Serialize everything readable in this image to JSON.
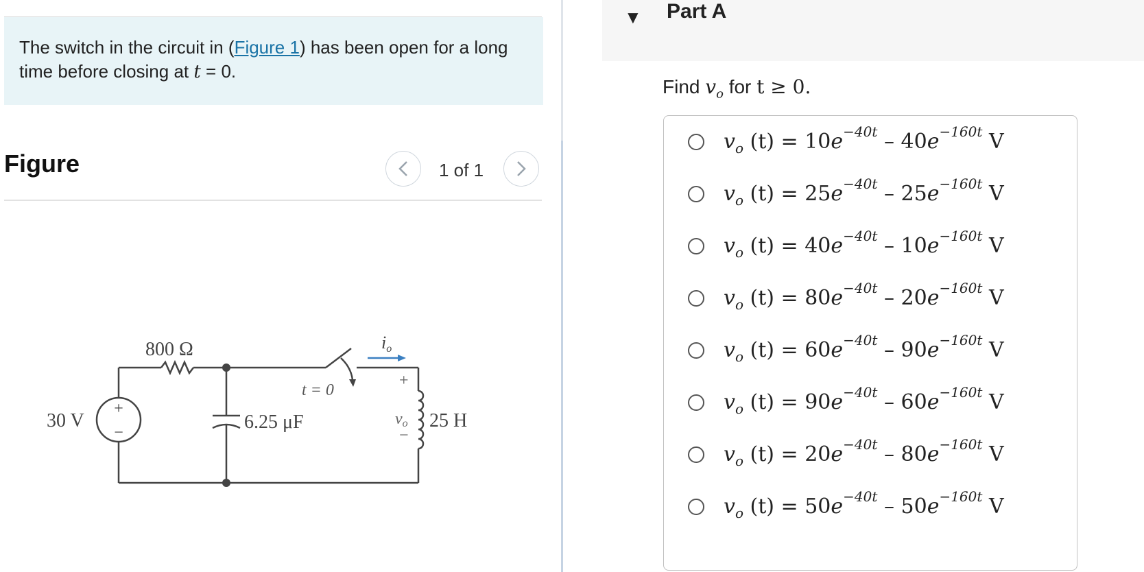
{
  "problem": {
    "text_before": "The switch in the circuit in (",
    "figure_link": "Figure 1",
    "text_middle": ") has been open for a long time before closing at ",
    "time_var": "t",
    "text_after": " = 0."
  },
  "figure": {
    "title": "Figure",
    "pager": "1 of 1",
    "circuit": {
      "source": "30 V",
      "resistor": "800 Ω",
      "capacitor": "6.25 μF",
      "inductor": "25 H",
      "switch_label": "t = 0",
      "current_label": "i",
      "current_sub": "o",
      "voltage_label": "v",
      "voltage_sub": "o",
      "plus": "+",
      "minus": "−"
    }
  },
  "part": {
    "title": "Part A",
    "question_prefix": "Find ",
    "question_var": "v",
    "question_sub": "o",
    "question_suffix": " for ",
    "question_condition": "t ≥ 0."
  },
  "options": [
    {
      "lhs": "v",
      "sub": "o",
      "mid": " (t) = ",
      "c1": "10",
      "e1": "−40t",
      "c2": "40",
      "e2": "−160t",
      "unit": "V"
    },
    {
      "lhs": "v",
      "sub": "o",
      "mid": " (t) = ",
      "c1": "25",
      "e1": "−40t",
      "c2": "25",
      "e2": "−160t",
      "unit": "V"
    },
    {
      "lhs": "v",
      "sub": "o",
      "mid": " (t) = ",
      "c1": "40",
      "e1": "−40t",
      "c2": "10",
      "e2": "−160t",
      "unit": "V"
    },
    {
      "lhs": "v",
      "sub": "o",
      "mid": " (t) = ",
      "c1": "80",
      "e1": "−40t",
      "c2": "20",
      "e2": "−160t",
      "unit": "V"
    },
    {
      "lhs": "v",
      "sub": "o",
      "mid": " (t) = ",
      "c1": "60",
      "e1": "−40t",
      "c2": "90",
      "e2": "−160t",
      "unit": "V"
    },
    {
      "lhs": "v",
      "sub": "o",
      "mid": " (t) = ",
      "c1": "90",
      "e1": "−40t",
      "c2": "60",
      "e2": "−160t",
      "unit": "V"
    },
    {
      "lhs": "v",
      "sub": "o",
      "mid": " (t) = ",
      "c1": "20",
      "e1": "−40t",
      "c2": "80",
      "e2": "−160t",
      "unit": "V"
    },
    {
      "lhs": "v",
      "sub": "o",
      "mid": " (t) = ",
      "c1": "50",
      "e1": "−40t",
      "c2": "50",
      "e2": "−160t",
      "unit": "V"
    }
  ]
}
